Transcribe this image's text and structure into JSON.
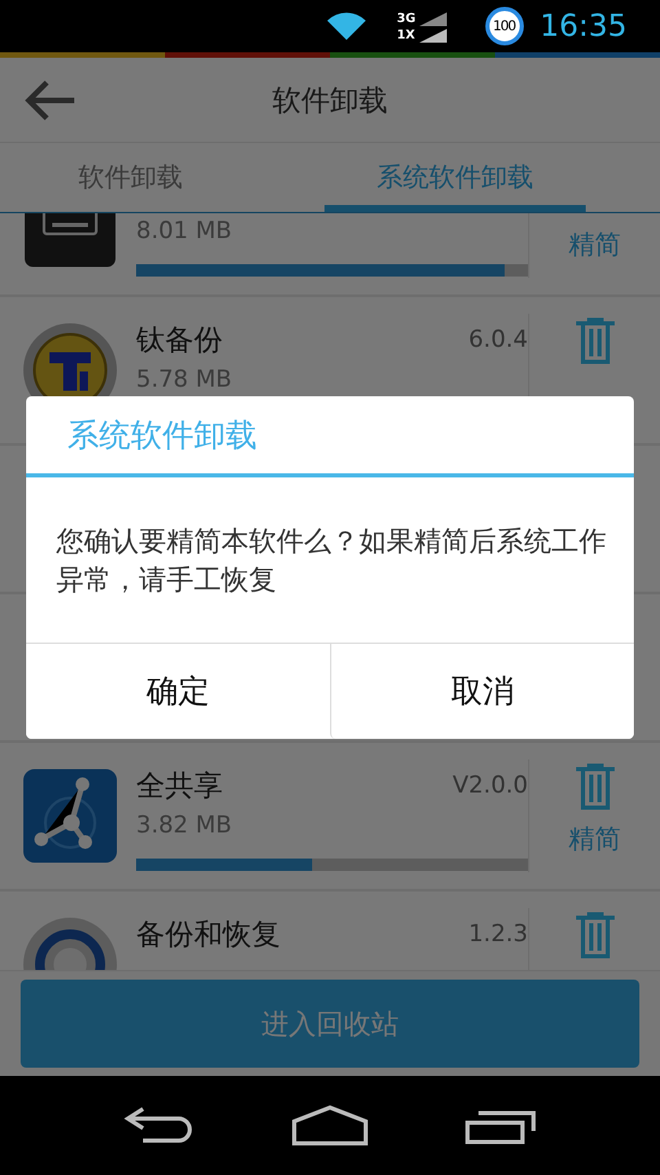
{
  "status_bar": {
    "network_top": "3G",
    "network_bottom": "1X",
    "battery": "100",
    "time": "16:35"
  },
  "app_bar": {
    "title": "软件卸载"
  },
  "tabs": [
    {
      "label": "软件卸载",
      "selected": false
    },
    {
      "label": "系统软件卸载",
      "selected": true
    }
  ],
  "rows": [
    {
      "size": "8.01 MB",
      "level": 0.94,
      "action": "精简"
    },
    {
      "name": "钛备份",
      "version": "6.0.4",
      "size": "5.78 MB"
    },
    {
      "name": "全共享",
      "version": "V2.0.0",
      "size": "3.82 MB",
      "level": 0.45,
      "action": "精简"
    },
    {
      "name": "备份和恢复",
      "version": "1.2.3"
    }
  ],
  "bottom_button": {
    "label": "进入回收站"
  },
  "dialog": {
    "title": "系统软件卸载",
    "message": "您确认要精简本软件么？如果精简后系统工作异常，请手工恢复",
    "buttons": [
      "确定",
      "取消"
    ]
  }
}
